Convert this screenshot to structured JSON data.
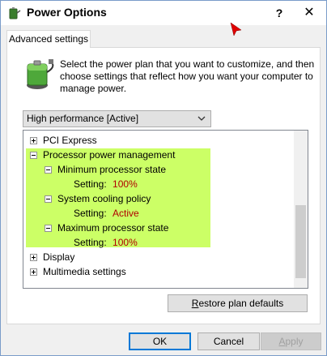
{
  "window": {
    "title": "Power Options",
    "help_label": "?",
    "close_label": "✕"
  },
  "tabs": [
    {
      "label": "Advanced settings",
      "active": true
    }
  ],
  "intro_text": "Select the power plan that you want to customize, and then choose settings that reflect how you want your computer to manage power.",
  "plan_select": {
    "value": "High performance [Active]"
  },
  "tree": {
    "items": [
      {
        "label": "PCI Express",
        "expanded": false
      },
      {
        "label": "Processor power management",
        "expanded": true
      },
      {
        "label": "Minimum processor state",
        "expanded": true,
        "setting_label": "Setting:",
        "setting_value": "100%"
      },
      {
        "label": "System cooling policy",
        "expanded": true,
        "setting_label": "Setting:",
        "setting_value": "Active"
      },
      {
        "label": "Maximum processor state",
        "expanded": true,
        "setting_label": "Setting:",
        "setting_value": "100%"
      },
      {
        "label": "Display",
        "expanded": false
      },
      {
        "label": "Multimedia settings",
        "expanded": false
      }
    ],
    "highlight_color": "#ccff66",
    "value_color": "#b00000"
  },
  "buttons": {
    "restore_prefix": "R",
    "restore_rest": "estore plan defaults",
    "ok": "OK",
    "cancel": "Cancel",
    "apply_prefix": "A",
    "apply_rest": "pply"
  },
  "icons": {
    "title": "battery-plug-icon",
    "panel": "battery-plug-icon",
    "select_arrow": "chevron-down-icon"
  }
}
